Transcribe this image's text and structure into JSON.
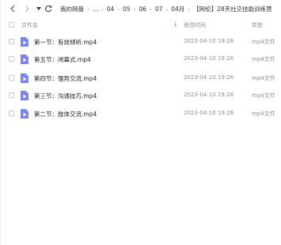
{
  "toolbar": {
    "breadcrumb": [
      "我的网盘",
      "...",
      "04",
      "05",
      "06",
      "07",
      "04月",
      "【网伦】28天社交技能训练营"
    ]
  },
  "columns": {
    "name": "文件名",
    "modified": "修改时间",
    "type": "类型"
  },
  "files": [
    {
      "name": "第一节：有效倾听.mp4",
      "modified": "2023-04-10 19:26",
      "type": "mp4文件"
    },
    {
      "name": "第五节：闭幕式.mp4",
      "modified": "2023-04-10 19:26",
      "type": "mp4文件"
    },
    {
      "name": "第四节：强势交流.mp4",
      "modified": "2023-04-10 19:26",
      "type": "mp4文件"
    },
    {
      "name": "第三节：沟通技巧.mp4",
      "modified": "2023-04-10 19:26",
      "type": "mp4文件"
    },
    {
      "name": "第二节：肢体交流.mp4",
      "modified": "2023-04-10 19:26",
      "type": "mp4文件"
    }
  ],
  "colors": {
    "accent": "#3b82f6",
    "file_icon": "#7b83eb"
  }
}
